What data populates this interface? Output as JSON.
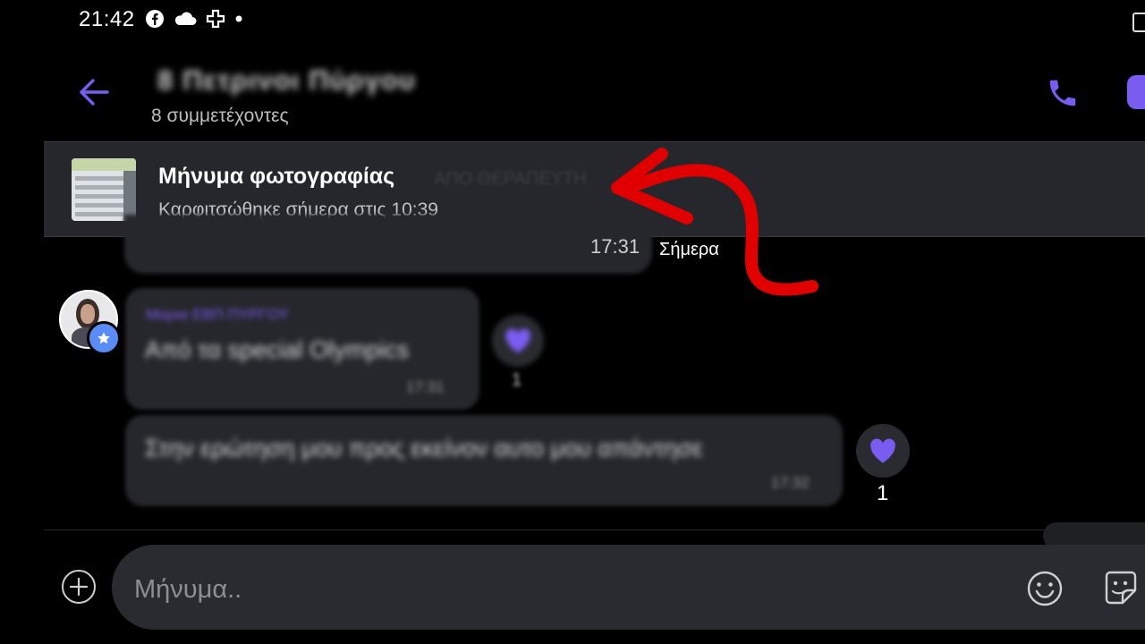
{
  "status_bar": {
    "time": "21:42",
    "icons": [
      "facebook-icon",
      "cloud-icon",
      "medical-cross-icon",
      "dot-icon"
    ]
  },
  "header": {
    "title": "8 Πετρινοι Πύργου",
    "participants": "8 συμμετέχοντες"
  },
  "pinned": {
    "title": "Μήνυμα φωτογραφίας",
    "subtitle": "Καρφιτσώθηκε σήμερα στις 10:39",
    "ghost_text": "ΑΠΟ ΘΕΡΑΠΕΥΤΗ"
  },
  "messages": {
    "prev_time": "17:31",
    "day_separator": "Σήμερα",
    "msg1": {
      "sender": "Μαρια ΕΒΠ ΠΥΡΓΟΥ",
      "text": "Από τα special Olympics",
      "time": "17:31",
      "reaction_count": "1"
    },
    "msg2": {
      "text": "Στην ερώτηση μου προς εκείνον αυτο μου απάντησε",
      "time": "17:32",
      "reaction_count": "1"
    }
  },
  "composer": {
    "placeholder": "Μήνυμα.."
  },
  "colors": {
    "accent": "#7a5cf0",
    "bubble": "#26272c",
    "annotation": "#e00000"
  }
}
